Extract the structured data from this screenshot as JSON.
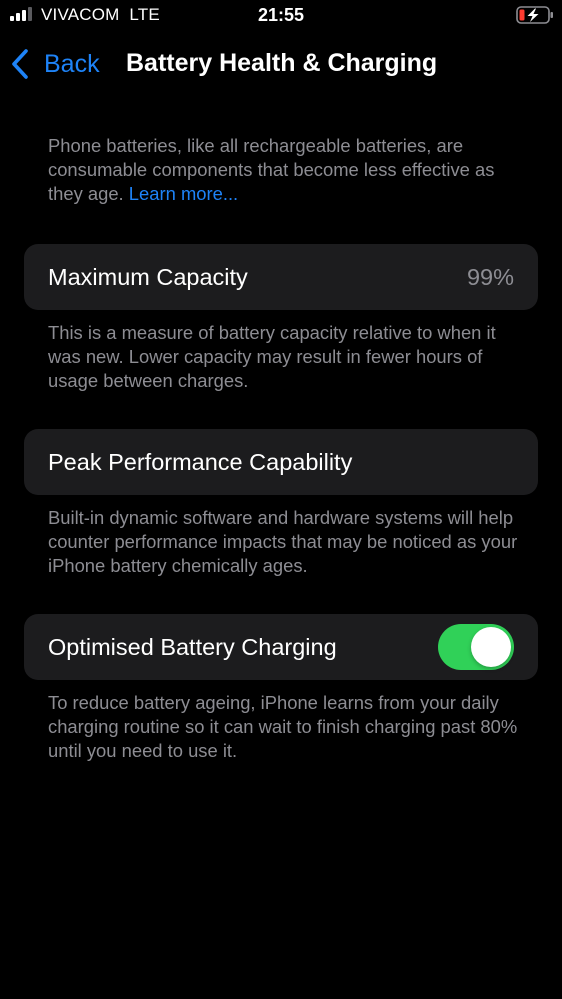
{
  "status_bar": {
    "carrier": "VIVACOM",
    "network": "LTE",
    "time": "21:55",
    "signal_bars_filled": 3,
    "signal_bars_total": 4,
    "battery_state": "charging-low",
    "battery_color": "#ff3b30"
  },
  "nav": {
    "back_label": "Back",
    "title": "Battery Health & Charging"
  },
  "intro": {
    "text": "Phone batteries, like all rechargeable batteries, are consumable components that become less effective as they age.",
    "link_label": "Learn more..."
  },
  "maximum_capacity": {
    "label": "Maximum Capacity",
    "value": "99%",
    "description": "This is a measure of battery capacity relative to when it was new. Lower capacity may result in fewer hours of usage between charges."
  },
  "peak_performance": {
    "label": "Peak Performance Capability",
    "description": "Built-in dynamic software and hardware systems will help counter performance impacts that may be noticed as your iPhone battery chemically ages."
  },
  "optimised_charging": {
    "label": "Optimised Battery Charging",
    "enabled": true,
    "description": "To reduce battery ageing, iPhone learns from your daily charging routine so it can wait to finish charging past 80% until you need to use it."
  },
  "colors": {
    "accent_blue": "#1e83f7",
    "toggle_on": "#30d158",
    "card_background": "#1c1c1e",
    "secondary_text": "#8d8d93"
  }
}
